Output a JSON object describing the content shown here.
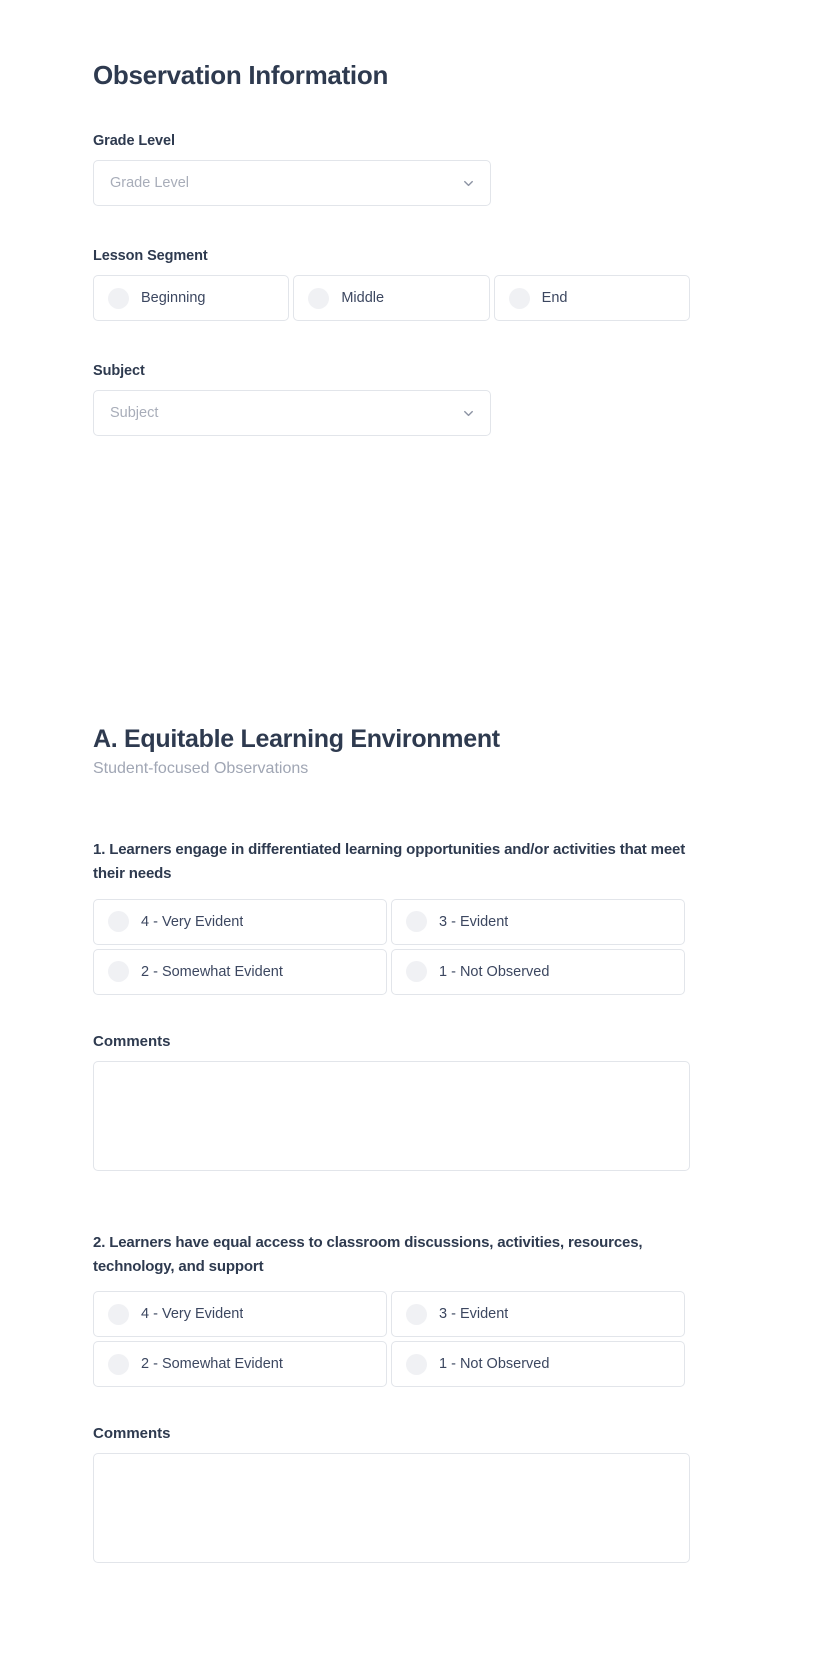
{
  "header": {
    "title": "Observation Information"
  },
  "observation_info": {
    "grade_level": {
      "label": "Grade Level",
      "placeholder": "Grade Level",
      "value": "",
      "icon": "chevron-down-icon"
    },
    "lesson_segment": {
      "label": "Lesson Segment",
      "options": [
        {
          "label": "Beginning",
          "selected": false
        },
        {
          "label": "Middle",
          "selected": false
        },
        {
          "label": "End",
          "selected": false
        }
      ]
    },
    "subject": {
      "label": "Subject",
      "placeholder": "Subject",
      "value": "",
      "icon": "chevron-down-icon"
    }
  },
  "section_a": {
    "title": "A. Equitable Learning Environment",
    "subtitle": "Student-focused Observations",
    "questions": [
      {
        "text": "1. Learners engage in differentiated learning opportunities and/or activities that meet their needs",
        "options": [
          {
            "label": "4 - Very Evident",
            "selected": false
          },
          {
            "label": "3 - Evident",
            "selected": false
          },
          {
            "label": "2 - Somewhat Evident",
            "selected": false
          },
          {
            "label": "1 - Not Observed",
            "selected": false
          }
        ],
        "comments": {
          "label": "Comments",
          "value": "",
          "placeholder": ""
        }
      },
      {
        "text": "2. Learners have equal access to classroom discussions, activities, resources, technology, and support",
        "options": [
          {
            "label": "4 - Very Evident",
            "selected": false
          },
          {
            "label": "3 - Evident",
            "selected": false
          },
          {
            "label": "2 - Somewhat Evident",
            "selected": false
          },
          {
            "label": "1 - Not Observed",
            "selected": false
          }
        ],
        "comments": {
          "label": "Comments",
          "value": "",
          "placeholder": ""
        }
      }
    ]
  },
  "colors": {
    "heading": "#2e3a4f",
    "body_text": "#3c4760",
    "placeholder": "#a8adb9",
    "subtitle": "#a0a6b4",
    "border": "#e2e5ea",
    "radio_fill": "#f0f1f4",
    "background": "#ffffff"
  }
}
